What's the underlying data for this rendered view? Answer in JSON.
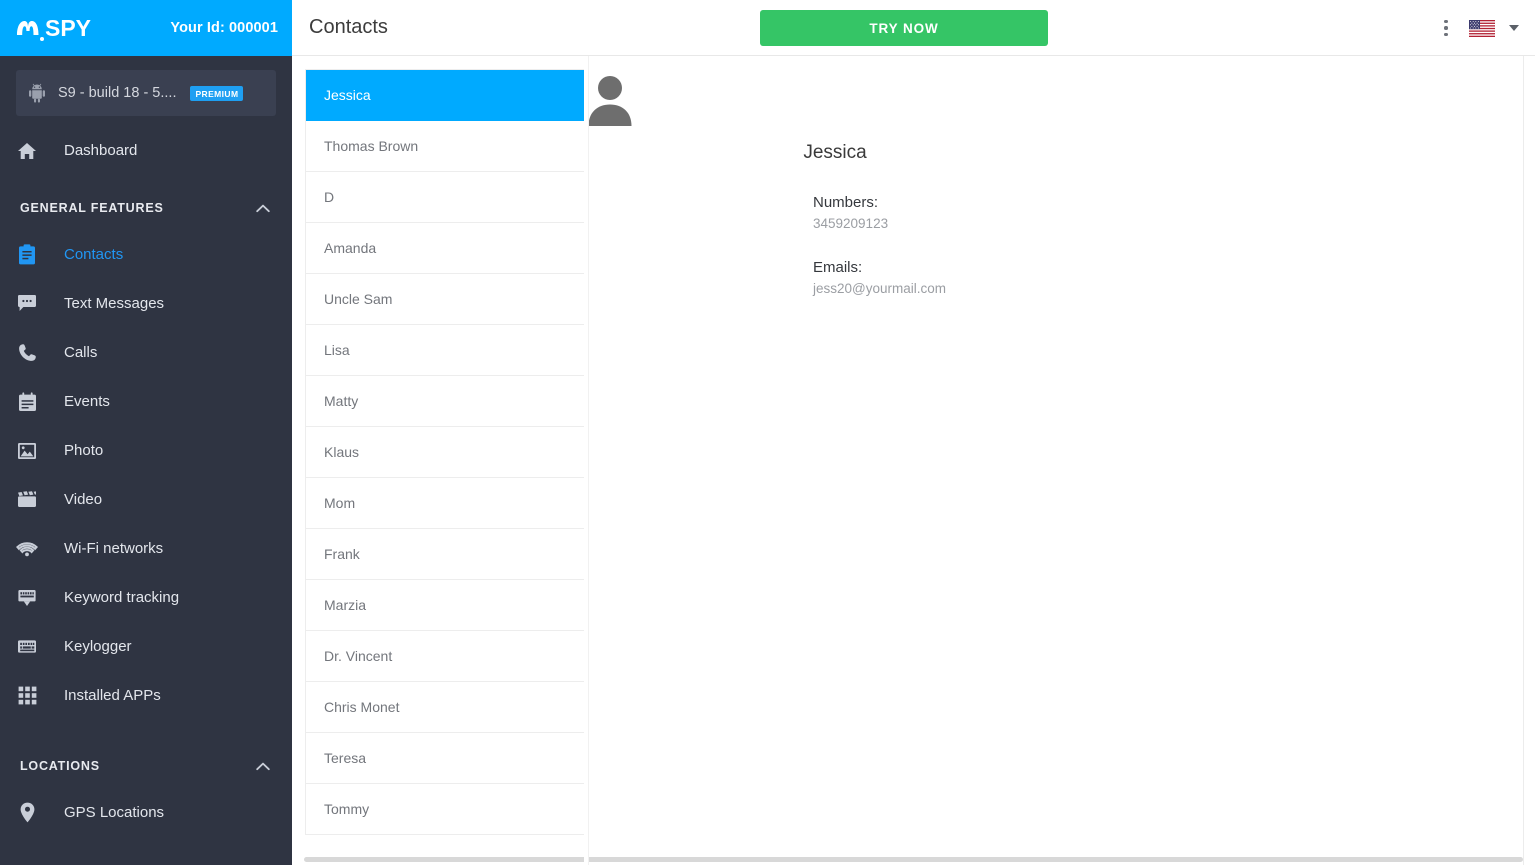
{
  "brand": {
    "logo_text": "SPY",
    "logo_full": "mSPY",
    "your_id_label": "Your Id: 000001"
  },
  "device": {
    "name": "S9 - build 18 - 5....",
    "badge": "PREMIUM",
    "icon": "android-icon"
  },
  "sidebar": {
    "top_items": [
      {
        "label": "Dashboard",
        "icon": "home-icon",
        "active": false
      }
    ],
    "sections": [
      {
        "title": "GENERAL FEATURES",
        "collapse_icon": "chevron-up-icon",
        "items": [
          {
            "label": "Contacts",
            "icon": "clipboard-icon",
            "active": true
          },
          {
            "label": "Text Messages",
            "icon": "chat-bubble-icon",
            "active": false
          },
          {
            "label": "Calls",
            "icon": "phone-icon",
            "active": false
          },
          {
            "label": "Events",
            "icon": "calendar-icon",
            "active": false
          },
          {
            "label": "Photo",
            "icon": "image-icon",
            "active": false
          },
          {
            "label": "Video",
            "icon": "clapperboard-icon",
            "active": false
          },
          {
            "label": "Wi-Fi networks",
            "icon": "wifi-icon",
            "active": false
          },
          {
            "label": "Keyword tracking",
            "icon": "keyboard-dropdown-icon",
            "active": false
          },
          {
            "label": "Keylogger",
            "icon": "keyboard-icon",
            "active": false
          },
          {
            "label": "Installed APPs",
            "icon": "grid-apps-icon",
            "active": false
          }
        ]
      },
      {
        "title": "LOCATIONS",
        "collapse_icon": "chevron-up-icon",
        "items": [
          {
            "label": "GPS Locations",
            "icon": "map-pin-icon",
            "active": false
          }
        ]
      }
    ]
  },
  "topbar": {
    "title": "Contacts",
    "try_now_label": "TRY NOW",
    "kebab_icon": "more-vertical-icon",
    "flag_icon": "us-flag-icon",
    "caret_icon": "chevron-down-icon"
  },
  "contacts": {
    "selected": "Jessica",
    "items": [
      "Jessica",
      "Thomas Brown",
      "D",
      "Amanda",
      "Uncle Sam",
      "Lisa",
      "Matty",
      "Klaus",
      "Mom",
      "Frank",
      "Marzia",
      "Dr. Vincent",
      "Chris Monet",
      "Teresa",
      "Tommy"
    ]
  },
  "detail": {
    "avatar_icon": "person-avatar-icon",
    "name": "Jessica",
    "numbers_label": "Numbers:",
    "numbers_value": "3459209123",
    "emails_label": "Emails:",
    "emails_value": "jess20@yourmail.com"
  },
  "colors": {
    "brand_blue": "#00aaff",
    "sidebar_dark": "#2f3442",
    "device_box": "#3a4051",
    "accent_green": "#35c566",
    "active_link": "#2196f3",
    "premium_badge": "#1e9ff2"
  }
}
